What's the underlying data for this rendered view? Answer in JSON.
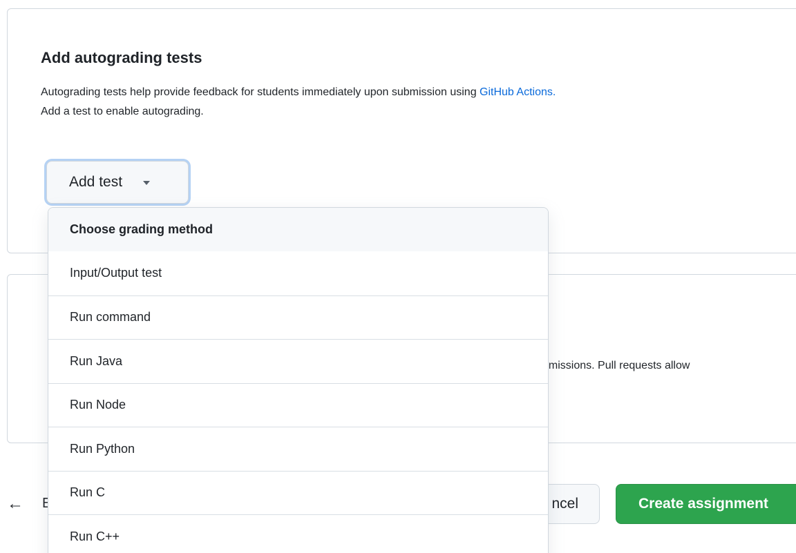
{
  "autograding": {
    "title": "Add autograding tests",
    "description_line1": "Autograding tests help provide feedback for students immediately upon submission using ",
    "github_actions_link": "GitHub Actions.",
    "description_line2": "Add a test to enable autograding.",
    "add_test_label": "Add test"
  },
  "dropdown": {
    "header": "Choose grading method",
    "items": [
      {
        "label": "Input/Output test"
      },
      {
        "label": "Run command"
      },
      {
        "label": "Run Java"
      },
      {
        "label": "Run Node"
      },
      {
        "label": "Run Python"
      },
      {
        "label": "Run C"
      },
      {
        "label": "Run C++"
      }
    ]
  },
  "feedback_section": {
    "visible_text": "omissions. Pull requests allow"
  },
  "footer": {
    "back_icon": "arrow-left-icon",
    "back_text_visible": "E",
    "cancel_label_visible": "ncel",
    "create_label": "Create assignment"
  },
  "colors": {
    "primary_green": "#2da44e",
    "link_blue": "#0969da",
    "border": "#d0d7de"
  }
}
